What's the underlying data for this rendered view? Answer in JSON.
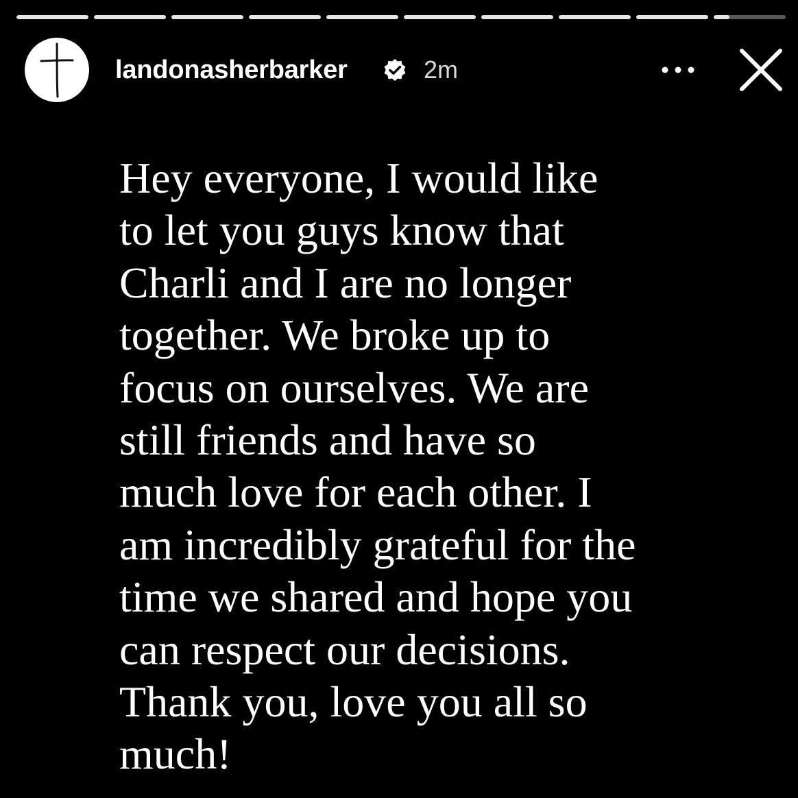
{
  "story": {
    "progress": {
      "segment_count": 10,
      "active_index": 9,
      "active_fill_fraction": 0.22
    },
    "header": {
      "username": "landonasherbarker",
      "verified": true,
      "timestamp": "2m",
      "avatar_icon": "cross-icon",
      "verified_icon": "verified-badge-icon",
      "more_icon": "more-options-icon",
      "close_icon": "close-icon"
    },
    "message_lines": [
      "Hey everyone, I would like",
      "to let you guys know that",
      "Charli and I are no longer",
      "together. We broke up to",
      "focus on ourselves. We are",
      "still friends and have so",
      "much love for each other. I",
      "am incredibly grateful for the",
      "time we shared and hope you",
      "can respect our decisions.",
      "Thank you, love you all so",
      "much!"
    ],
    "colors": {
      "background": "#000000",
      "text": "#ffffff",
      "progress_inactive": "rgba(255,255,255,0.35)",
      "progress_active": "#e6e6e6"
    }
  }
}
